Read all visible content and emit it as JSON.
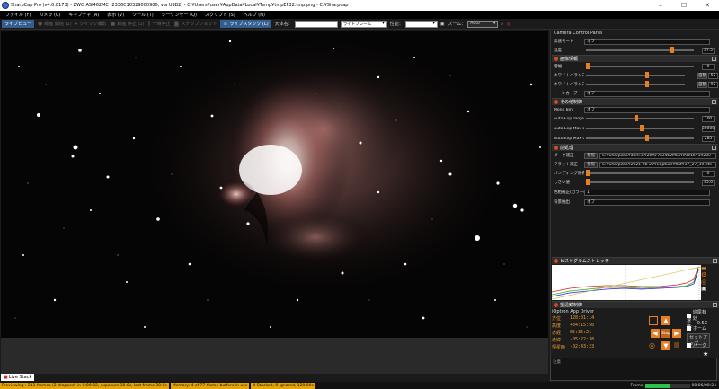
{
  "window": {
    "title": "SharpCap Pro (v4.0.8173) - ZWO ASI462MC (2336C10329000900, via USB2) - C:¥Users¥user¥AppData¥Local¥Temp¥tmpEF32.tmp.png - C:¥Sharpcap",
    "controls": [
      "–",
      "☐",
      "✕"
    ]
  },
  "menu": [
    "ファイル (F)",
    "カメラ (C)",
    "キャプチャ (A)",
    "表示 (V)",
    "ツール (T)",
    "シーケンサー (Q)",
    "スクリプト (S)",
    "ヘルプ (H)"
  ],
  "toolbar": {
    "live": "ライブビュー",
    "capture": "録画 開始 (1)",
    "quick": "クイック撮影",
    "pause": "録画 停止 (2)",
    "stop": "一時停止",
    "snapshot": "スナップショット",
    "livestack": "ライブスタック (L)",
    "target_label": "天体名：",
    "target_value": "",
    "frame_label": "ライトフレーム",
    "profile_label": "性能：",
    "zoom_label": "ズーム：",
    "zoom_value": "Auto"
  },
  "image_tab": "Live Stack",
  "status": {
    "previewing": "Previewing : 211 frames (2 dropped) in 0:00:02, exposure 30.0s, last frame 30.0s",
    "memory": "Memory: 4 of 77 frame buffers in use",
    "stacked": "4 Stacked, 0 Ignored, 120.00s",
    "frames_label": "Frame",
    "frame_progress": 0.55,
    "time": "00:06/00:24"
  },
  "panel": {
    "title": "Camera Control Panel",
    "top_rows": [
      {
        "label": "高速モード",
        "value": "オフ"
      },
      {
        "label": "温度",
        "value": "37.5",
        "slider": 0.78
      }
    ],
    "image_section": {
      "title": "画像情報",
      "rows": [
        {
          "label": "増幅",
          "value": "0",
          "slider": 0.02
        },
        {
          "label": "ホワイトバランス(赤)",
          "value": "52",
          "slider": 0.55,
          "auto": "自動"
        },
        {
          "label": "ホワイトバランス(青)",
          "value": "92",
          "slider": 0.55,
          "auto": "自動"
        },
        {
          "label": "トーンカーブ",
          "value": "オフ"
        }
      ]
    },
    "other_section": {
      "title": "その他制御",
      "rows": [
        {
          "label": "Mono Bin",
          "value": "オフ"
        },
        {
          "label": "Auto Exp Target Brightness",
          "value": "100",
          "slider": 0.45
        },
        {
          "label": "Auto Exp Max Exp M S",
          "value": "30000",
          "slider": 0.5
        },
        {
          "label": "Auto Exp Max Gain",
          "value": "285",
          "slider": 0.55
        }
      ]
    },
    "pre_section": {
      "title": "前処理",
      "rows": [
        {
          "label": "ダーク補正",
          "button": "参照",
          "value": "C:¥Sharpcap¥dark.sl¥ZWO ASI462MC¥RAW16¥1920x"
        },
        {
          "label": "フラット補正",
          "button": "参照",
          "value": "C:¥Sharpcap¥2021-08-29¥Capture¥flat¥17_27_39.fits"
        },
        {
          "label": "バンディング除去",
          "value": "0",
          "slider": 0.0
        },
        {
          "label": "しきい値",
          "value": "35.0",
          "slider": 0.0
        },
        {
          "label": "色相補正(カラーの場合のみ)",
          "value": "1"
        },
        {
          "label": "背景抽出",
          "value": "オフ"
        }
      ]
    },
    "histogram": {
      "title": "ヒストグラムストレッチ"
    },
    "scope": {
      "title": "望遠鏡制御",
      "driver": "iOptron App Driver",
      "ra_label": "方位",
      "ra": "128:01:14",
      "alt_label": "高度",
      "alt": "+34:15:56",
      "dec_label": "赤経",
      "dec": "05:36:21",
      "decl_label": "赤緯",
      "decl": "-05:22:38",
      "lst_label": "恒星時",
      "lst": "-02:43:23",
      "tracking_label": "追尾有効",
      "rate_label": "速度:",
      "rate_value": "0.5X",
      "parked_label": "ホーム",
      "setup_label": "セットアップ",
      "park_label": "パーク"
    },
    "notes_label": "注意"
  }
}
